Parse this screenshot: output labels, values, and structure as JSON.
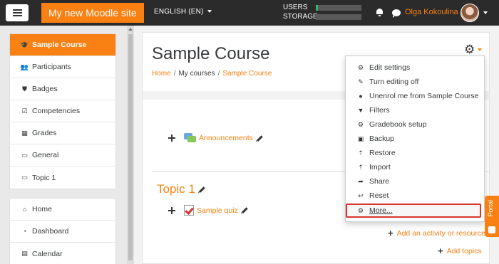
{
  "navbar": {
    "site_name": "My new Moodle site",
    "language": "ENGLISH (EN)",
    "usage": [
      {
        "label": "USERS",
        "fraction": 0.05
      },
      {
        "label": "STORAGE",
        "fraction": 0.0
      }
    ],
    "user_name": "Olga Kokoulina",
    "icons": {
      "menu": "hamburger-icon",
      "notifications": "bell-icon",
      "messages": "chat-bubble-icon"
    }
  },
  "sidebar": {
    "course_items": [
      {
        "label": "Sample Course",
        "icon": "graduation-cap-icon",
        "active": true
      },
      {
        "label": "Participants",
        "icon": "users-icon"
      },
      {
        "label": "Badges",
        "icon": "shield-icon"
      },
      {
        "label": "Competencies",
        "icon": "checkbox-icon"
      },
      {
        "label": "Grades",
        "icon": "table-icon"
      },
      {
        "label": "General",
        "icon": "folder-icon"
      },
      {
        "label": "Topic 1",
        "icon": "folder-icon"
      }
    ],
    "site_items": [
      {
        "label": "Home",
        "icon": "home-icon"
      },
      {
        "label": "Dashboard",
        "icon": "dashboard-icon"
      },
      {
        "label": "Calendar",
        "icon": "calendar-icon"
      }
    ]
  },
  "page": {
    "title": "Sample Course",
    "breadcrumb": {
      "home": "Home",
      "my_courses": "My courses",
      "current": "Sample Course"
    }
  },
  "content": {
    "announcements": "Announcements",
    "topic_title": "Topic 1",
    "quiz": "Sample quiz",
    "add_activity": "Add an activity or resource",
    "add_topics": "Add topics"
  },
  "settings_menu": [
    {
      "label": "Edit settings",
      "icon": "gear-icon"
    },
    {
      "label": "Turn editing off",
      "icon": "pencil-icon"
    },
    {
      "label": "Unenrol me from Sample Course",
      "icon": "user-icon"
    },
    {
      "label": "Filters",
      "icon": "filter-icon"
    },
    {
      "label": "Gradebook setup",
      "icon": "gear-icon"
    },
    {
      "label": "Backup",
      "icon": "file-icon"
    },
    {
      "label": "Restore",
      "icon": "upload-icon"
    },
    {
      "label": "Import",
      "icon": "upload-icon"
    },
    {
      "label": "Share",
      "icon": "share-icon"
    },
    {
      "label": "Reset",
      "icon": "reply-icon"
    },
    {
      "label": "More...",
      "icon": "gear-icon",
      "highlighted": true
    }
  ],
  "portal_tab": "Portal",
  "colors": {
    "brand": "#f98012",
    "navbar": "#2b2b2b",
    "highlight_border": "#d9312b"
  }
}
